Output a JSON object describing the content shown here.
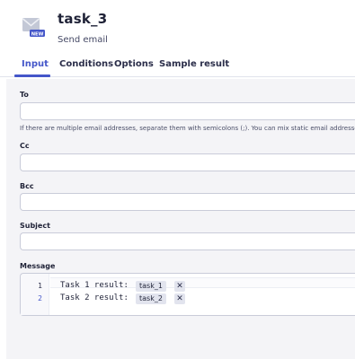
{
  "header": {
    "icon": "email-new-icon",
    "badge": "NEW",
    "title": "task_3",
    "subtitle": "Send email"
  },
  "tabs": [
    {
      "label": "Input",
      "active": true
    },
    {
      "label": "Conditions",
      "active": false
    },
    {
      "label": "Options",
      "active": false
    },
    {
      "label": "Sample result",
      "active": false
    }
  ],
  "form": {
    "to": {
      "label": "To",
      "value": ""
    },
    "to_help": "If there are multiple email addresses, separate them with semicolons (;). You can mix static email addresses",
    "cc": {
      "label": "Cc",
      "value": ""
    },
    "bcc": {
      "label": "Bcc",
      "value": ""
    },
    "subject": {
      "label": "Subject",
      "value": ""
    },
    "message": {
      "label": "Message",
      "lines": [
        {
          "number": "1",
          "text": "Task 1 result:",
          "token": "task_1"
        },
        {
          "number": "2",
          "text": "Task 2 result:",
          "token": "task_2"
        }
      ],
      "remove_glyph": "✕"
    }
  },
  "colors": {
    "accent": "#4456c9",
    "field_border": "#c9ccd9",
    "panel_bg": "#f4f4f7",
    "chip_bg": "#e2e4ee"
  }
}
